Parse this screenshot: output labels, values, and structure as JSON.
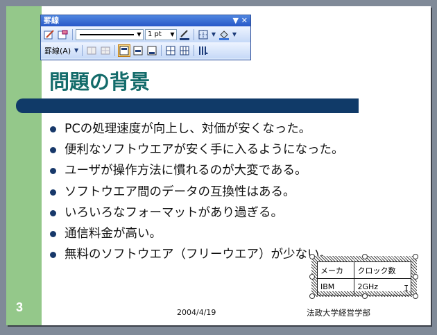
{
  "toolbar": {
    "title": "罫線",
    "title_buttons": "▼ ✕",
    "line_weight": "1 pt",
    "borders_menu_label": "罫線(A)",
    "row1_icons": [
      "draw-table-icon",
      "eraser-icon",
      "line-style-dropdown",
      "line-weight-dropdown",
      "pen-color-icon",
      "border-icon",
      "fill-color-icon"
    ],
    "row2_icons": [
      "merge-cells-icon",
      "split-cells-icon",
      "align-top-icon",
      "align-center-icon",
      "align-bottom-icon",
      "distribute-rows-icon",
      "distribute-columns-icon",
      "text-direction-icon"
    ]
  },
  "slide": {
    "number": "3",
    "title": "問題の背景",
    "bullets": [
      "PCの処理速度が向上し、対価が安くなった。",
      "便利なソフトウエアが安く手に入るようになった。",
      "ユーザが操作方法に慣れるのが大変である。",
      "ソフトウエア間のデータの互換性はある。",
      "いろいろなフォーマットがあり過ぎる。",
      "通信料金が高い。",
      "無料のソフトウエア（フリーウエア）が少ない。"
    ],
    "footer_date": "2004/4/19",
    "footer_org": "法政大学経営学部",
    "table": {
      "headers": [
        "メーカ",
        "クロック数"
      ],
      "rows": [
        [
          "IBM",
          "2GHz"
        ]
      ]
    }
  },
  "colors": {
    "accent_green": "#94c88a",
    "title_color": "#136b6a",
    "bar_navy": "#103a68"
  }
}
